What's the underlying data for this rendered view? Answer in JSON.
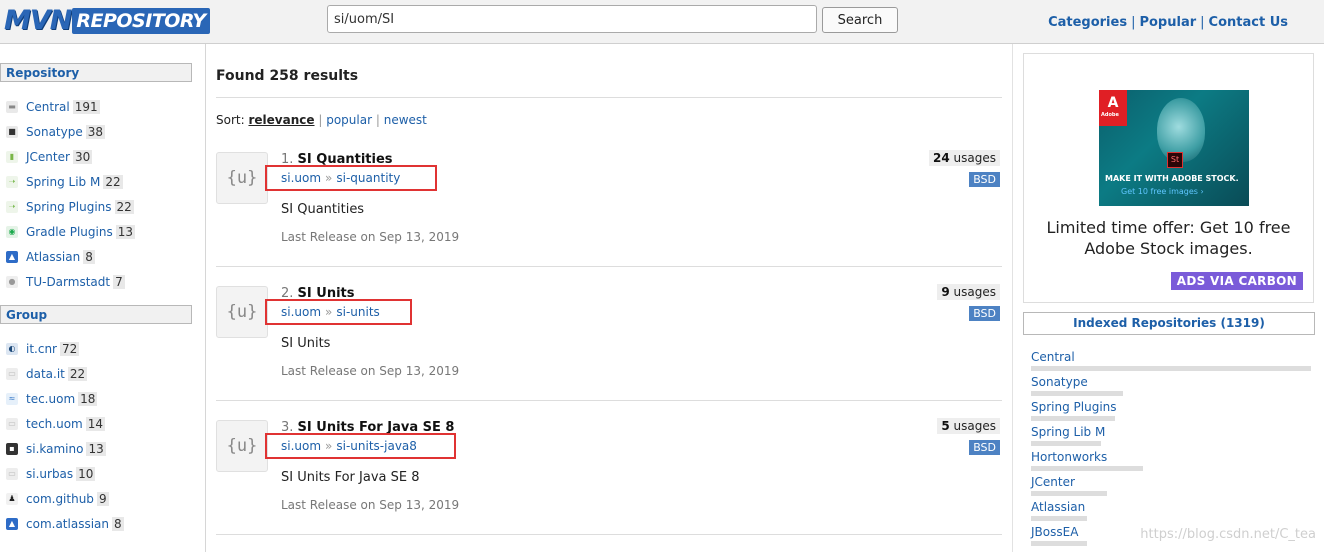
{
  "header": {
    "logo_mvn": "MVN",
    "logo_repo": "REPOSITORY",
    "search_value": "si/uom/SI",
    "search_button": "Search",
    "nav": [
      "Categories",
      "Popular",
      "Contact Us"
    ],
    "nav_sep": "|"
  },
  "left": {
    "repository_heading": "Repository",
    "repositories": [
      {
        "label": "Central",
        "count": "191",
        "icon": "central-icon"
      },
      {
        "label": "Sonatype",
        "count": "38",
        "icon": "sonatype-icon"
      },
      {
        "label": "JCenter",
        "count": "30",
        "icon": "jcenter-icon"
      },
      {
        "label": "Spring Lib M",
        "count": "22",
        "icon": "spring-icon"
      },
      {
        "label": "Spring Plugins",
        "count": "22",
        "icon": "spring-icon"
      },
      {
        "label": "Gradle Plugins",
        "count": "13",
        "icon": "gradle-icon"
      },
      {
        "label": "Atlassian",
        "count": "8",
        "icon": "atlassian-icon"
      },
      {
        "label": "TU-Darmstadt",
        "count": "7",
        "icon": "tu-darmstadt-icon"
      }
    ],
    "group_heading": "Group",
    "groups": [
      {
        "label": "it.cnr",
        "count": "72",
        "icon": "cnr-icon"
      },
      {
        "label": "data.it",
        "count": "22",
        "icon": "group-icon"
      },
      {
        "label": "tec.uom",
        "count": "18",
        "icon": "tec-icon"
      },
      {
        "label": "tech.uom",
        "count": "14",
        "icon": "group-icon"
      },
      {
        "label": "si.kamino",
        "count": "13",
        "icon": "kamino-icon"
      },
      {
        "label": "si.urbas",
        "count": "10",
        "icon": "group-icon"
      },
      {
        "label": "com.github",
        "count": "9",
        "icon": "github-icon"
      },
      {
        "label": "com.atlassian",
        "count": "8",
        "icon": "atlassian-icon"
      }
    ]
  },
  "main": {
    "found": "Found 258 results",
    "sort_label": "Sort:",
    "sort_options": [
      "relevance",
      "popular",
      "newest"
    ],
    "results": [
      {
        "num": "1.",
        "name": "SI Quantities",
        "group": "si.uom",
        "artifact": "si-quantity",
        "desc": "SI Quantities",
        "release": "Last Release on Sep 13, 2019",
        "usages_count": "24",
        "usages_label": "usages",
        "license": "BSD"
      },
      {
        "num": "2.",
        "name": "SI Units",
        "group": "si.uom",
        "artifact": "si-units",
        "desc": "SI Units",
        "release": "Last Release on Sep 13, 2019",
        "usages_count": "9",
        "usages_label": "usages",
        "license": "BSD"
      },
      {
        "num": "3.",
        "name": "SI Units For Java SE 8",
        "group": "si.uom",
        "artifact": "si-units-java8",
        "desc": "SI Units For Java SE 8",
        "release": "Last Release on Sep 13, 2019",
        "usages_count": "5",
        "usages_label": "usages",
        "license": "BSD"
      }
    ],
    "im_icon_text": "{u}",
    "raquo": "»"
  },
  "right": {
    "ad": {
      "adobe_logo": "A",
      "adobe_word": "Adobe",
      "st_badge": "St",
      "image_headline": "MAKE IT WITH ADOBE STOCK.",
      "image_sub": "Get 10 free images ›",
      "text": "Limited time offer: Get 10 free Adobe Stock images.",
      "button": "ADS VIA CARBON"
    },
    "indexed_heading": "Indexed Repositories (1319)",
    "indexed": [
      {
        "label": "Central",
        "share": 1.0
      },
      {
        "label": "Sonatype",
        "share": 0.33
      },
      {
        "label": "Spring Plugins",
        "share": 0.3
      },
      {
        "label": "Spring Lib M",
        "share": 0.25
      },
      {
        "label": "Hortonworks",
        "share": 0.4
      },
      {
        "label": "JCenter",
        "share": 0.27
      },
      {
        "label": "Atlassian",
        "share": 0.2
      },
      {
        "label": "JBossEA",
        "share": 0.2
      }
    ]
  },
  "watermark": "https://blog.csdn.net/C_tea",
  "colors": {
    "link": "#1d5fa8",
    "highlight_box": "#e03333",
    "license_badge": "#4d82c3",
    "carbon": "#7a5bd9"
  }
}
